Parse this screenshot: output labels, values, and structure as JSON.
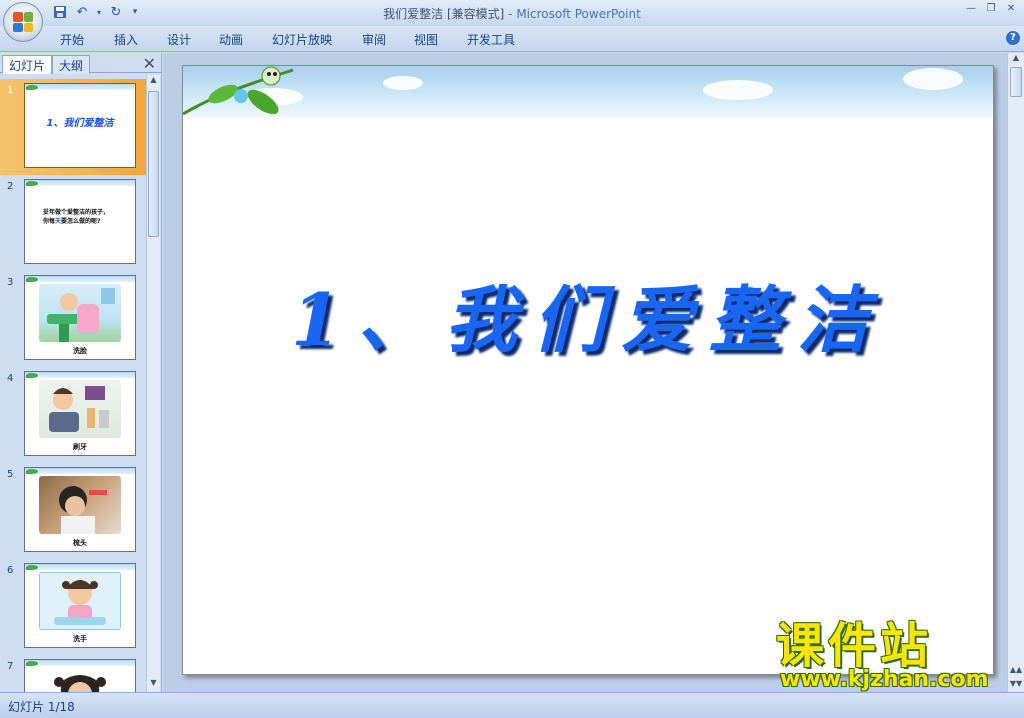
{
  "window": {
    "title": "我们爱整洁 [兼容模式]",
    "app_name": " - Microsoft PowerPoint",
    "minimize_label": "—",
    "restore_label": "❐",
    "close_label": "✕"
  },
  "qat": {
    "save_icon": "save-icon",
    "undo_icon": "undo-icon",
    "redo_icon": "redo-icon",
    "customize_icon": "customize-qat-icon"
  },
  "ribbon": {
    "tabs": [
      "开始",
      "插入",
      "设计",
      "动画",
      "幻灯片放映",
      "审阅",
      "视图",
      "开发工具"
    ],
    "help_label": "?"
  },
  "pane": {
    "tabs": [
      "幻灯片",
      "大纲"
    ],
    "close_label": "✕",
    "thumbnails": [
      {
        "number": "1",
        "title": "1、我们爱整洁"
      },
      {
        "number": "2",
        "line1": "妥年做个爱整洁的孩子，",
        "line2a": "你每",
        "line2b": "天",
        "line2c": "要怎么做的呢?"
      },
      {
        "number": "3",
        "caption": "洗脸"
      },
      {
        "number": "4",
        "caption": "刷牙"
      },
      {
        "number": "5",
        "caption": "梳头"
      },
      {
        "number": "6",
        "caption": "洗手"
      },
      {
        "number": "7"
      }
    ]
  },
  "slide": {
    "title": "1、我们爱整洁"
  },
  "status": {
    "text": "幻灯片 1/18"
  },
  "watermark": {
    "title": "课件站",
    "url": "www.kjzhan.com"
  }
}
